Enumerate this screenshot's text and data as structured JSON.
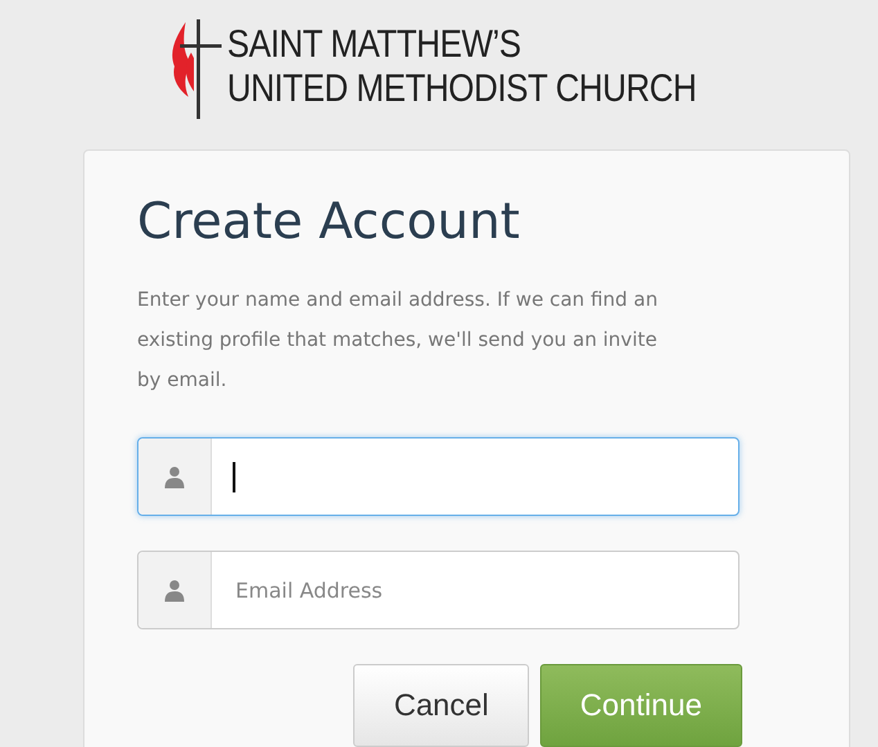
{
  "logo": {
    "line_1": "SAINT MATTHEW’S",
    "line_2": "UNITED METHODIST CHURCH"
  },
  "card": {
    "title": "Create Account",
    "intro": "Enter your name and email address. If we can find an existing profile that matches, we'll send you an invite by email."
  },
  "fields": [
    {
      "focused": true
    },
    {
      "placeholder": "Email Address",
      "focused": false
    }
  ],
  "buttons": [
    {
      "label": "Cancel",
      "kind": "default"
    },
    {
      "label": "Continue",
      "kind": "primary"
    }
  ]
}
